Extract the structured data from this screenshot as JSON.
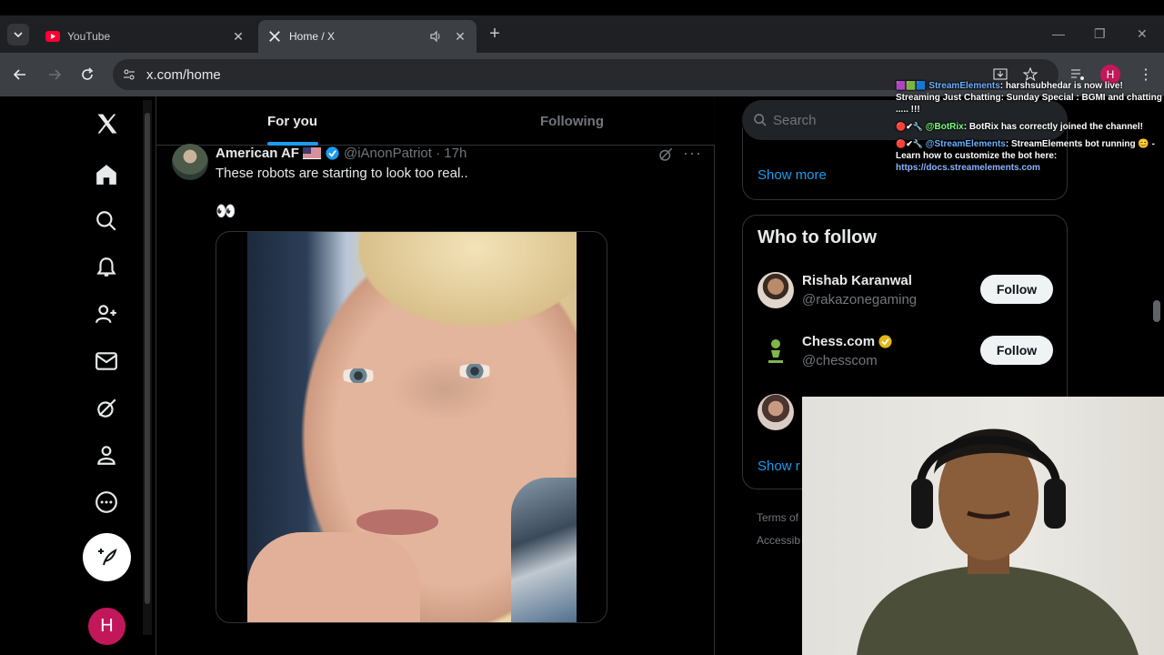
{
  "browser": {
    "tabs": [
      {
        "title": "YouTube",
        "active": false
      },
      {
        "title": "Home / X",
        "active": true
      }
    ],
    "url": "x.com/home"
  },
  "feed": {
    "tabs": [
      "For you",
      "Following"
    ],
    "tweet": {
      "name": "American AF",
      "handle": "@iAnonPatriot · 17h",
      "text": "These robots are starting to look too real..",
      "emoji": "👀"
    }
  },
  "sidebar": {
    "search_placeholder": "Search",
    "show_more": "Show more",
    "who_to_follow": "Who to follow",
    "suggestions": [
      {
        "name": "Rishab Karanwal",
        "handle": "@rakazonegaming",
        "button": "Follow"
      },
      {
        "name": "Chess.com",
        "handle": "@chesscom",
        "button": "Follow"
      }
    ],
    "show_more_2": "Show r",
    "footer_1": "Terms of",
    "footer_2": "Accessib"
  },
  "user_initial": "H",
  "chat": [
    {
      "user": "StreamElements",
      "text": ": harshsubhedar is now live! Streaming Just Chatting: Sunday Special : BGMI and chatting ..... !!!"
    },
    {
      "user": "@BotRix",
      "text": ": BotRix has correctly joined the channel!"
    },
    {
      "user": "@StreamElements",
      "text": ": StreamElements bot running 😊 - Learn how to customize the bot here:",
      "link": "https://docs.streamelements.com"
    }
  ],
  "colors": {
    "accent": "#1d9bf0",
    "chrome_bg": "#3c3f44",
    "youtube_red": "#ff0033"
  }
}
